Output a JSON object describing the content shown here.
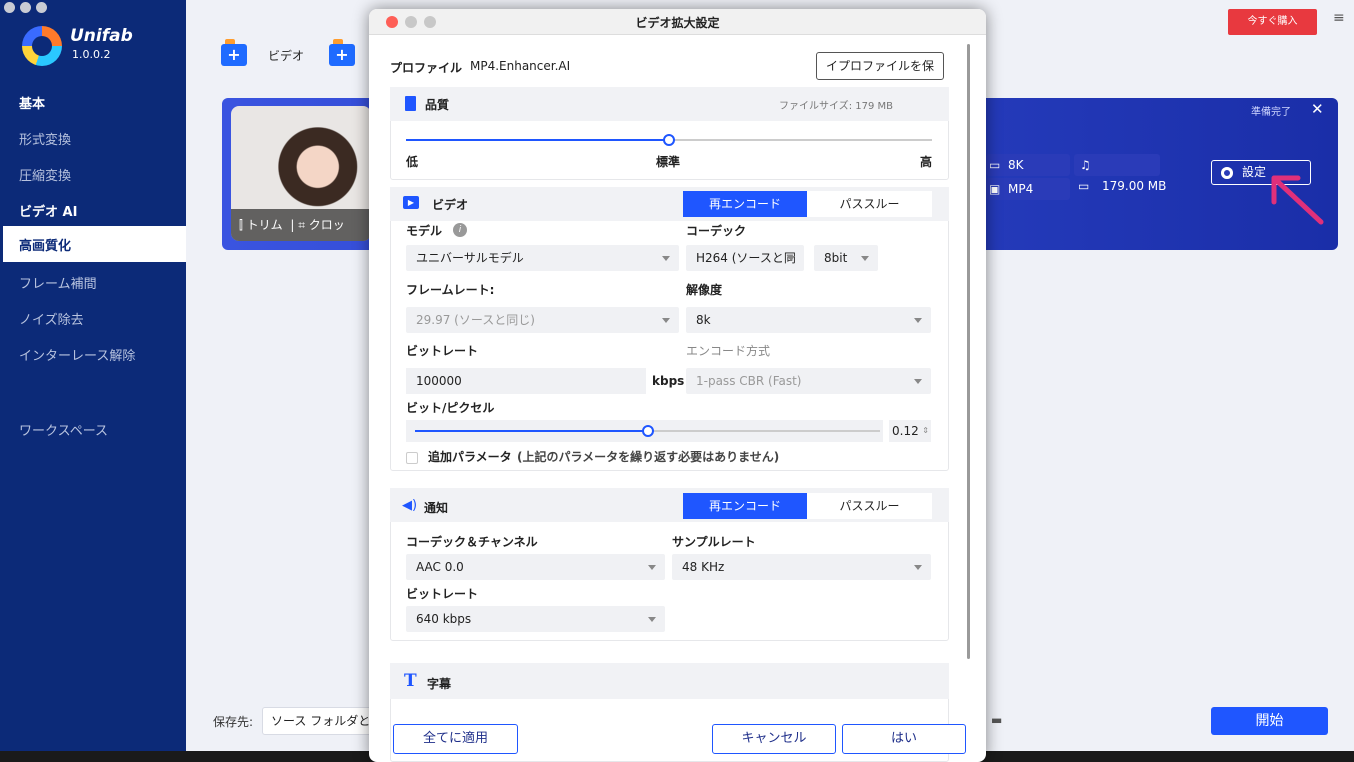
{
  "app": {
    "name": "Unifab",
    "version": "1.0.0.2"
  },
  "sidebar": {
    "items": [
      {
        "label": "基本",
        "type": "header"
      },
      {
        "label": "形式変換"
      },
      {
        "label": "圧縮変換"
      },
      {
        "label": "ビデオ AI",
        "type": "header"
      },
      {
        "label": "高画質化",
        "active": true
      },
      {
        "label": "フレーム補間"
      },
      {
        "label": "ノイズ除去"
      },
      {
        "label": "インターレース解除"
      },
      {
        "label": "ワークスペース"
      }
    ]
  },
  "toolbar": {
    "add_video_label": "ビデオ",
    "buy_label": "今すぐ購入"
  },
  "card": {
    "status": "準備完了",
    "trim_label": "トリム",
    "crop_label": "クロッ",
    "resolution": "8K",
    "format": "MP4",
    "audio": "",
    "size": "179.00 MB",
    "settings_label": "設定"
  },
  "footer": {
    "save_label": "保存先:",
    "save_value": "ソース フォルダと",
    "start_label": "開始"
  },
  "dialog": {
    "title": "ビデオ拡大設定",
    "profile_label": "プロファイル",
    "profile_value": "MP4.Enhancer.AI",
    "save_profile_label": "イプロファイルを保",
    "quality": {
      "title": "品質",
      "filesize_label": "ファイルサイズ: 179 MB",
      "low": "低",
      "standard": "標準",
      "high": "高",
      "level": 0.5
    },
    "video": {
      "title": "ビデオ",
      "reencode": "再エンコード",
      "passthrough": "パススルー",
      "model_label": "モデル",
      "model_value": "ユニバーサルモデル",
      "codec_label": "コーデック",
      "codec_value": "H264 (ソースと同",
      "bitdepth_value": "8bit",
      "framerate_label": "フレームレート:",
      "framerate_value": "29.97 (ソースと同じ)",
      "resolution_label": "解像度",
      "resolution_value": "8k",
      "bitrate_label": "ビットレート",
      "bitrate_value": "100000",
      "bitrate_unit": "kbps",
      "encode_label": "エンコード方式",
      "encode_value": "1-pass CBR (Fast)",
      "bpp_label": "ビット/ピクセル",
      "bpp_value": "0.12",
      "bpp_level": 0.5,
      "extra_label": "追加パラメータ",
      "extra_note": "(上記のパラメータを繰り返す必要はありません)"
    },
    "audio": {
      "title": "通知",
      "reencode": "再エンコード",
      "passthrough": "パススルー",
      "codec_label": "コーデック＆チャンネル",
      "codec_value": "AAC 0.0",
      "samplerate_label": "サンプルレート",
      "samplerate_value": "48 KHz",
      "bitrate_label": "ビットレート",
      "bitrate_value": "640 kbps"
    },
    "subtitle": {
      "title": "字幕"
    },
    "buttons": {
      "apply_all": "全てに適用",
      "cancel": "キャンセル",
      "ok": "はい"
    }
  },
  "colors": {
    "sidebar": "#0c2a78",
    "accent": "#1f56ff",
    "buy": "#e8393f"
  }
}
